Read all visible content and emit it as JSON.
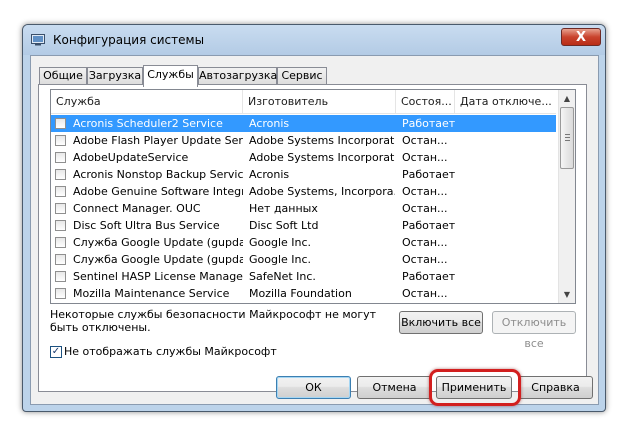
{
  "window": {
    "title": "Конфигурация системы",
    "close_symbol": "X",
    "icon": "system-config-icon"
  },
  "tabs": [
    {
      "label": "Общие"
    },
    {
      "label": "Загрузка"
    },
    {
      "label": "Службы"
    },
    {
      "label": "Автозагрузка"
    },
    {
      "label": "Сервис"
    }
  ],
  "active_tab": "Службы",
  "services_table": {
    "columns": [
      "Служба",
      "Изготовитель",
      "Состоя...",
      "Дата отключе..."
    ],
    "rows": [
      {
        "name": "Acronis Scheduler2 Service",
        "manufacturer": "Acronis",
        "status": "Работает",
        "selected": true
      },
      {
        "name": "Adobe Flash Player Update Service",
        "manufacturer": "Adobe Systems Incorporated",
        "status": "Остан..."
      },
      {
        "name": "AdobeUpdateService",
        "manufacturer": "Adobe Systems Incorporated",
        "status": "Остан..."
      },
      {
        "name": "Acronis Nonstop Backup Service",
        "manufacturer": "Acronis",
        "status": "Работает"
      },
      {
        "name": "Adobe Genuine Software Integri...",
        "manufacturer": "Adobe Systems, Incorpora...",
        "status": "Остан..."
      },
      {
        "name": "Connect Manager. OUC",
        "manufacturer": "Нет данных",
        "status": "Остан..."
      },
      {
        "name": "Disc Soft Ultra Bus Service",
        "manufacturer": "Disc Soft Ltd",
        "status": "Работает"
      },
      {
        "name": "Служба Google Update (gupdate)",
        "manufacturer": "Google Inc.",
        "status": "Остан..."
      },
      {
        "name": "Служба Google Update (gupdatem)",
        "manufacturer": "Google Inc.",
        "status": "Остан..."
      },
      {
        "name": "Sentinel HASP License Manager",
        "manufacturer": "SafeNet Inc.",
        "status": "Работает"
      },
      {
        "name": "Mozilla Maintenance Service",
        "manufacturer": "Mozilla Foundation",
        "status": "Остан..."
      }
    ]
  },
  "note_text": "Некоторые службы безопасности Майкрософт не могут быть отключены.",
  "buttons": {
    "enable_all": "Включить все",
    "disable_all": "Отключить все",
    "ok": "ОК",
    "cancel": "Отмена",
    "apply": "Применить",
    "help": "Справка"
  },
  "hide_microsoft": {
    "label": "Не отображать службы Майкрософт",
    "checked": true,
    "check_mark": "✓"
  },
  "colors": {
    "selection": "#3399ff",
    "highlight_ring": "#d21f1f"
  }
}
